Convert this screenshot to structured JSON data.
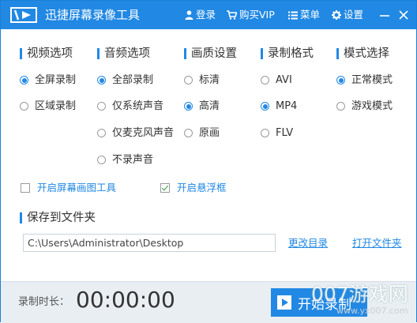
{
  "titlebar": {
    "app_title": "迅捷屏幕录像工具",
    "login": "登录",
    "buy_vip": "购买VIP",
    "menu": "菜单",
    "settings": "设置",
    "accent_color": "#2188e3"
  },
  "sections": {
    "video": {
      "title": "视频选项",
      "options": [
        "全屏录制",
        "区域录制"
      ],
      "selected": "全屏录制"
    },
    "audio": {
      "title": "音频选项",
      "options": [
        "全部录制",
        "仅系统声音",
        "仅麦克风声音",
        "不录声音"
      ],
      "selected": "全部录制"
    },
    "quality": {
      "title": "画质设置",
      "options": [
        "标清",
        "高清",
        "原画"
      ],
      "selected": "高清"
    },
    "format": {
      "title": "录制格式",
      "options": [
        "AVI",
        "MP4",
        "FLV"
      ],
      "selected": "MP4"
    },
    "mode": {
      "title": "模式选择",
      "options": [
        "正常模式",
        "游戏模式"
      ],
      "selected": "正常模式"
    }
  },
  "checkboxes": {
    "screen_draw": {
      "label": "开启屏幕画图工具",
      "checked": false
    },
    "floating_window": {
      "label": "开启悬浮框",
      "checked": true
    }
  },
  "save": {
    "title": "保存到文件夹",
    "path": "C:\\Users\\Administrator\\Desktop",
    "change_dir": "更改目录",
    "open_folder": "打开文件夹"
  },
  "footer": {
    "duration_label": "录制时长：",
    "duration_value": "00:00:00",
    "start_button": "开始录制"
  },
  "watermark": {
    "text": "007游戏网",
    "url": "www.yx007.com"
  }
}
